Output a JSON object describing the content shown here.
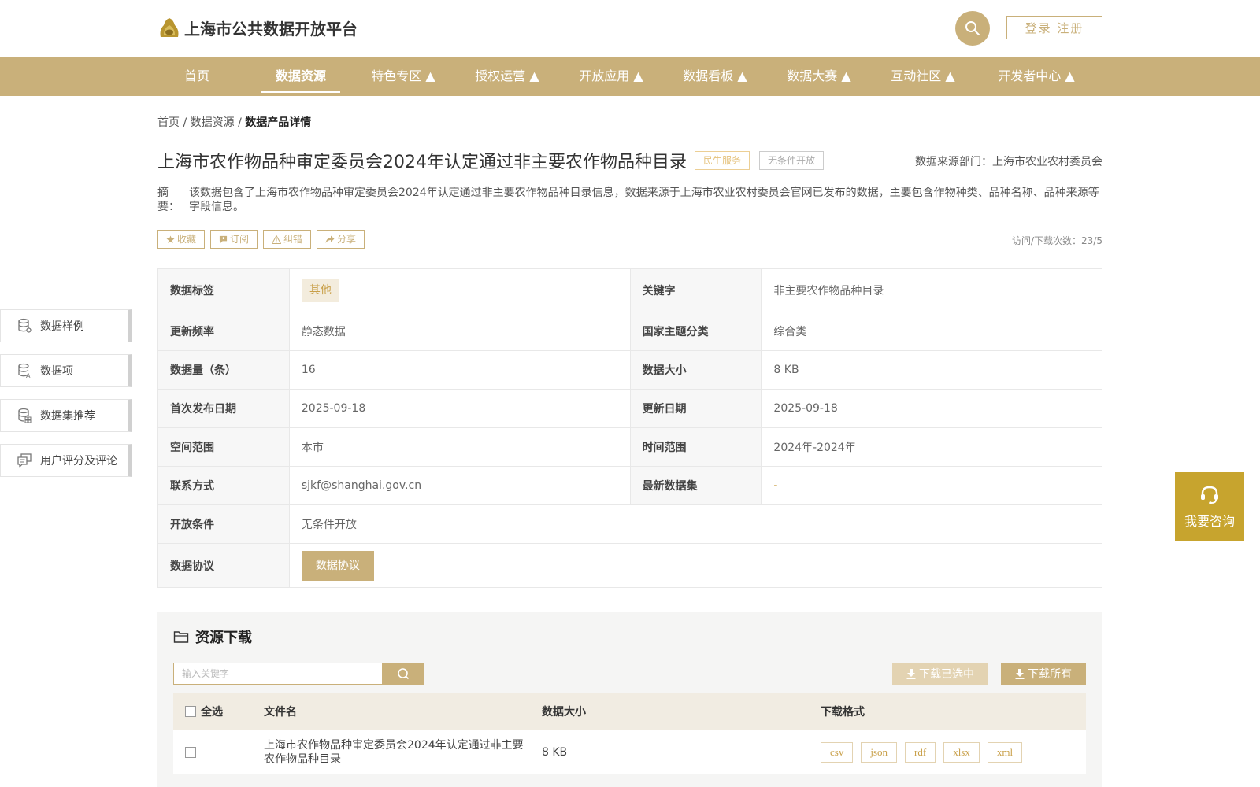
{
  "header": {
    "site_title": "上海市公共数据开放平台",
    "login_label": "登录 注册"
  },
  "nav": {
    "items": [
      {
        "label": "首页"
      },
      {
        "label": "数据资源"
      },
      {
        "label": "特色专区 ▲"
      },
      {
        "label": "授权运营 ▲"
      },
      {
        "label": "开放应用 ▲"
      },
      {
        "label": "数据看板 ▲"
      },
      {
        "label": "数据大赛 ▲"
      },
      {
        "label": "互动社区 ▲"
      },
      {
        "label": "开发者中心 ▲"
      }
    ],
    "active": "数据资源"
  },
  "breadcrumb": {
    "home": "首页",
    "resources": "数据资源",
    "current": "数据产品详情",
    "sep": " / "
  },
  "dataset": {
    "title": "上海市农作物品种审定委员会2024年认定通过非主要农作物品种目录",
    "tag_service": "民生服务",
    "tag_open": "无条件开放",
    "source_label": "数据来源部门：上海市农业农村委员会",
    "abstract_label": "摘　要：",
    "abstract_text": "该数据包含了上海市农作物品种审定委员会2024年认定通过非主要农作物品种目录信息，数据来源于上海市农业农村委员会官网已发布的数据，主要包含作物种类、品种名称、品种来源等字段信息。",
    "visits": "访问/下载次数：23/5"
  },
  "actions": {
    "favorite": "收藏",
    "subscribe": "订阅",
    "correct": "纠错",
    "share": "分享"
  },
  "info": {
    "tag_key": "数据标签",
    "tag_val": "其他",
    "keyword_key": "关键字",
    "keyword_val": "非主要农作物品种目录",
    "freq_key": "更新频率",
    "freq_val": "静态数据",
    "theme_key": "国家主题分类",
    "theme_val": "综合类",
    "count_key": "数据量（条）",
    "count_val": "16",
    "size_key": "数据大小",
    "size_val": "8 KB",
    "first_key": "首次发布日期",
    "first_val": "2025-09-18",
    "update_key": "更新日期",
    "update_val": "2025-09-18",
    "space_key": "空间范围",
    "space_val": "本市",
    "time_key": "时间范围",
    "time_val": "2024年-2024年",
    "contact_key": "联系方式",
    "contact_val": "sjkf@shanghai.gov.cn",
    "latest_key": "最新数据集",
    "latest_val": "-",
    "cond_key": "开放条件",
    "cond_val": "无条件开放",
    "protocol_key": "数据协议",
    "protocol_btn": "数据协议"
  },
  "sidebar": {
    "items": [
      {
        "label": "数据样例"
      },
      {
        "label": "数据项"
      },
      {
        "label": "数据集推荐"
      },
      {
        "label": "用户评分及评论"
      }
    ]
  },
  "consult": {
    "label": "我要咨询"
  },
  "download": {
    "title": "资源下载",
    "search_placeholder": "输入关键字",
    "download_selected": "下载已选中",
    "download_all": "下载所有",
    "columns": {
      "select_all": "全选",
      "file_name": "文件名",
      "data_size": "数据大小",
      "format": "下载格式"
    },
    "files": [
      {
        "name": "上海市农作物品种审定委员会2024年认定通过非主要农作物品种目录",
        "size": "8 KB",
        "formats": [
          "csv",
          "json",
          "rdf",
          "xlsx",
          "xml"
        ]
      }
    ]
  },
  "colors": {
    "brand": "#c9b07a",
    "consult": "#c7a42e",
    "tag_gold": "#c9a04a"
  }
}
